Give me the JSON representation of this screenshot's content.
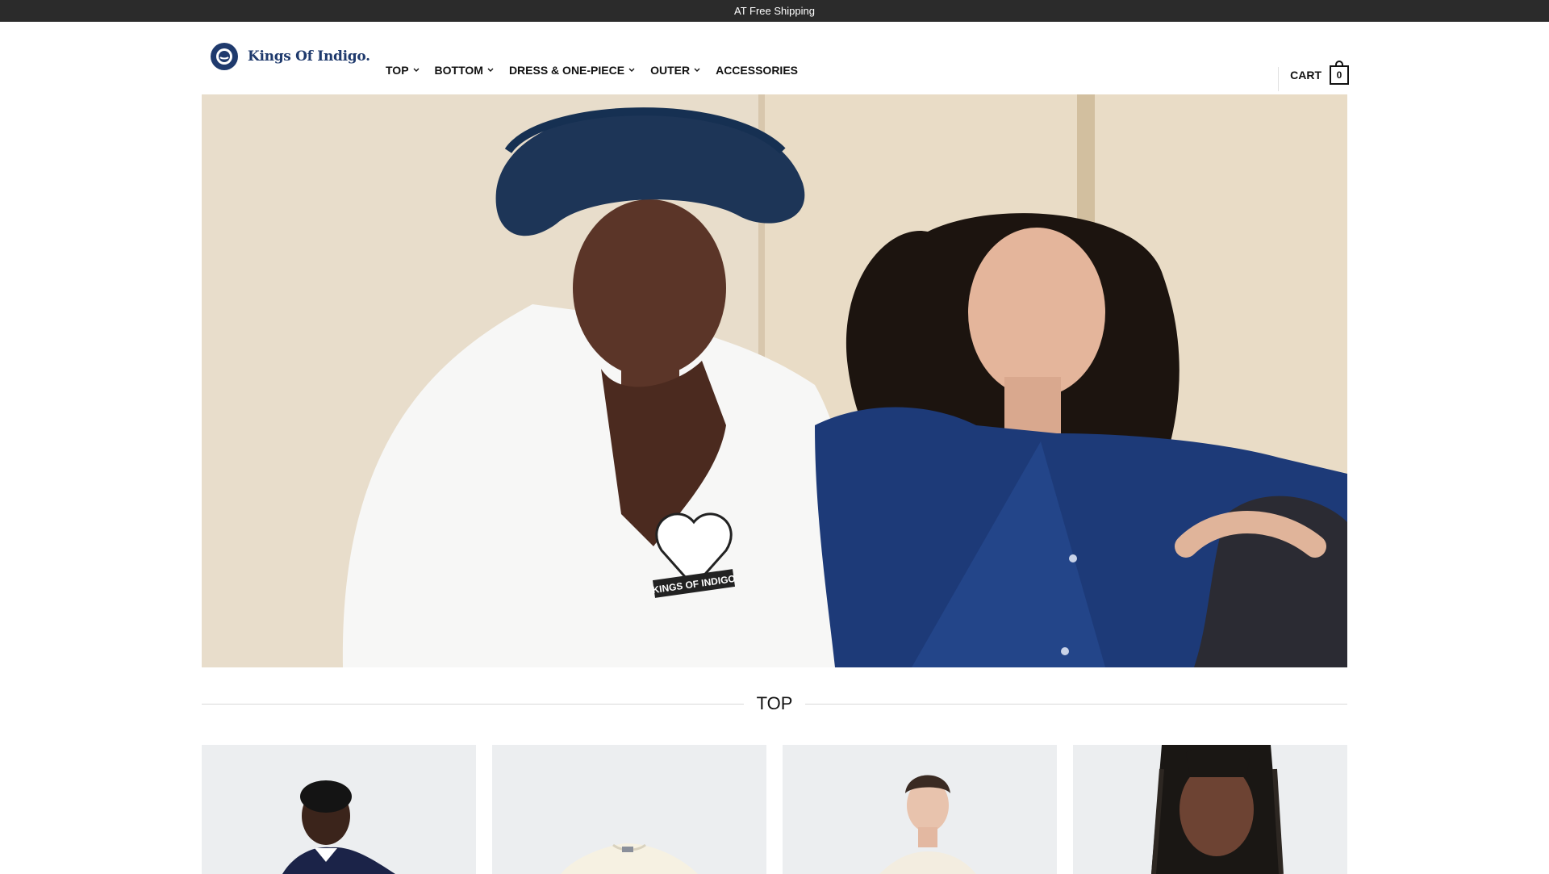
{
  "announcement": "AT Free Shipping",
  "brand": {
    "name": "Kings Of Indigo.",
    "color": "#1f3a6d"
  },
  "nav": {
    "items": [
      {
        "label": "TOP",
        "has_dropdown": true
      },
      {
        "label": "BOTTOM",
        "has_dropdown": true
      },
      {
        "label": "DRESS & ONE-PIECE",
        "has_dropdown": true
      },
      {
        "label": "OUTER",
        "has_dropdown": true
      },
      {
        "label": "ACCESSORIES",
        "has_dropdown": false
      }
    ]
  },
  "cart": {
    "label": "CART",
    "count": "0"
  },
  "hero": {
    "tshirt_print": "KINGS OF INDIGO"
  },
  "section": {
    "title": "TOP"
  },
  "colors": {
    "topbar": "#2b2b2b",
    "accent": "#1f3a6d"
  }
}
